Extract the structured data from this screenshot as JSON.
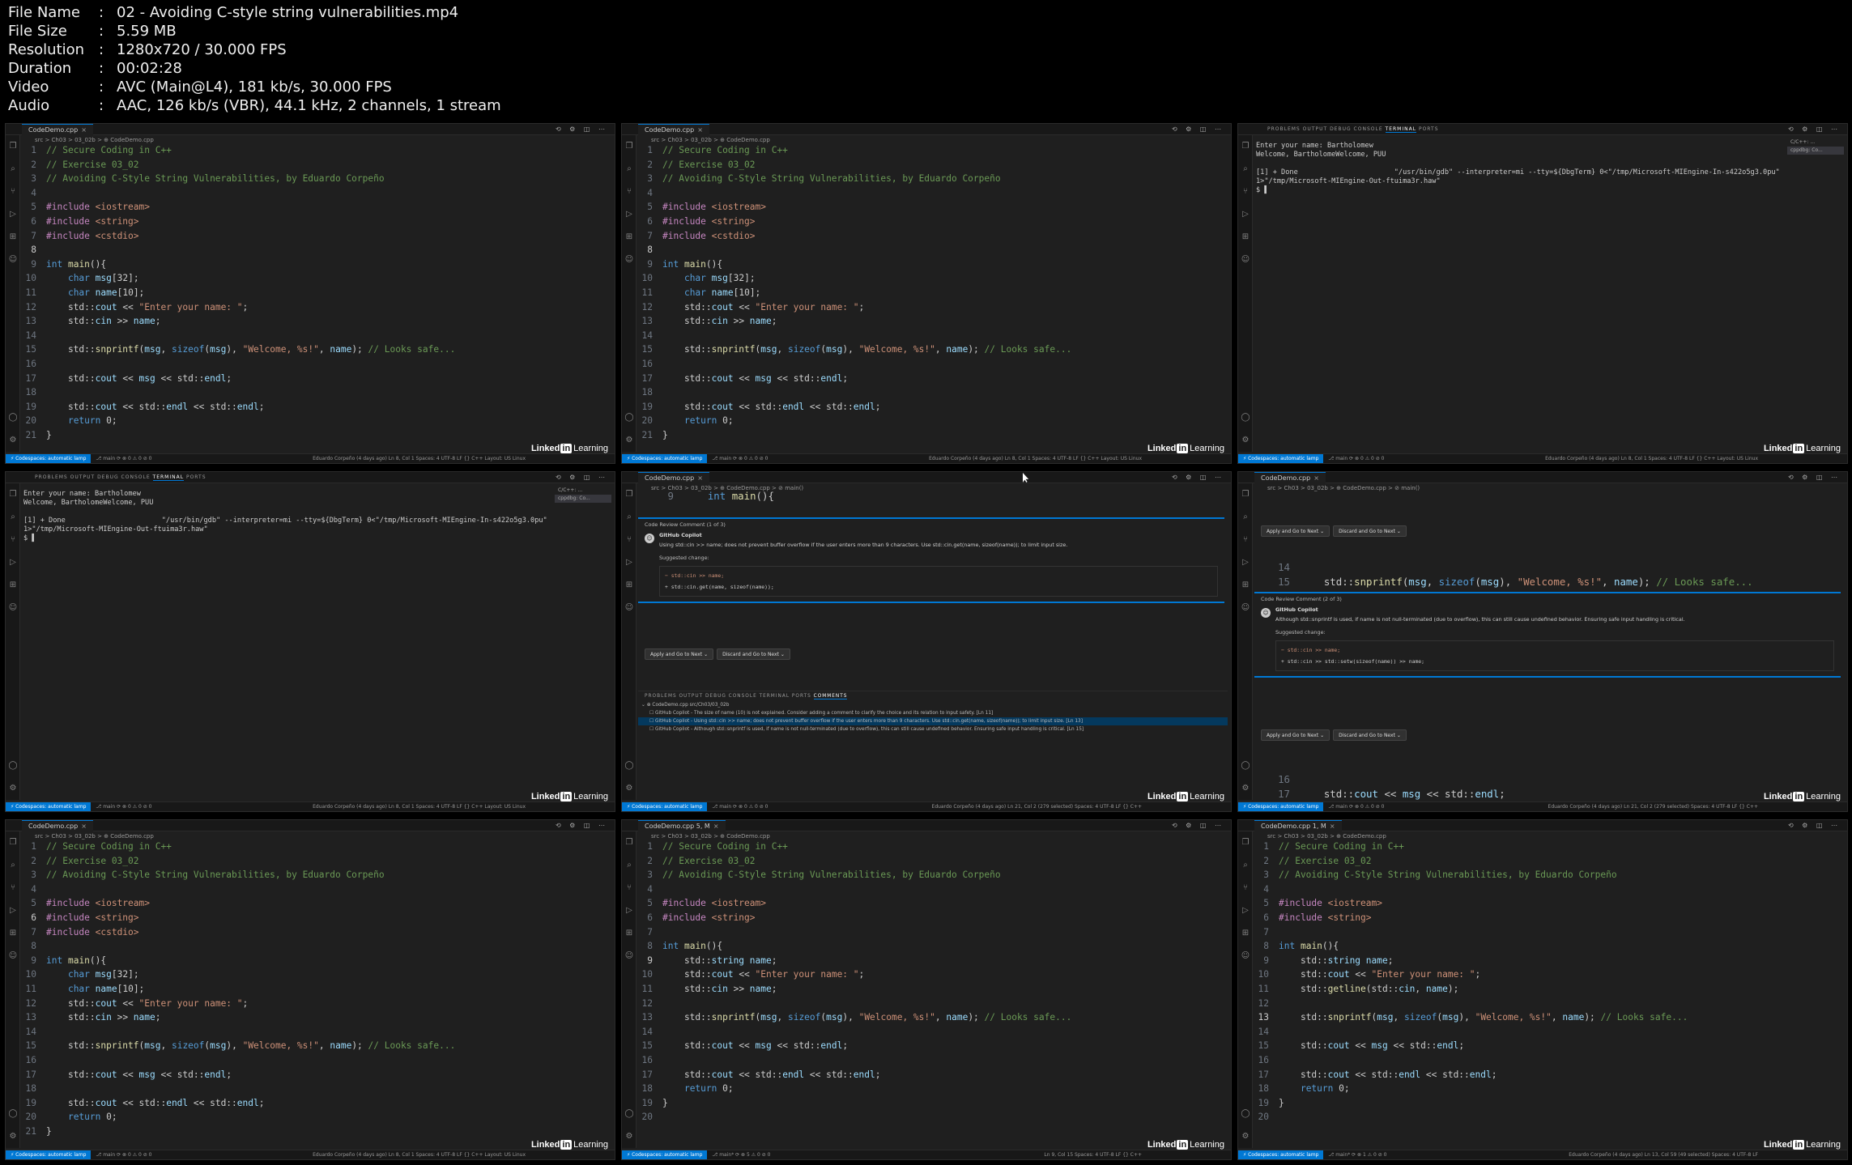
{
  "meta": [
    {
      "key": "File Name",
      "value": "02 - Avoiding C-style string vulnerabilities.mp4"
    },
    {
      "key": "File Size",
      "value": "5.59 MB"
    },
    {
      "key": "Resolution",
      "value": "1280x720 / 30.000 FPS"
    },
    {
      "key": "Duration",
      "value": "00:02:28"
    },
    {
      "key": "Video",
      "value": "AVC (Main@L4), 181 kb/s, 30.000 FPS"
    },
    {
      "key": "Audio",
      "value": "AAC, 126 kb/s (VBR), 44.1 kHz, 2 channels, 1 stream"
    }
  ],
  "editor": {
    "tab": "CodeDemo.cpp",
    "tab_modified": "CodeDemo.cpp 5, M",
    "tab_modified2": "CodeDemo.cpp 1, M",
    "breadcrumb": "src > Ch03 > 03_02b > ⊕ CodeDemo.cpp",
    "breadcrumb_main": "src > Ch03 > 03_02b > ⊕ CodeDemo.cpp > ⊘ main()",
    "actions": "⟲ ⚙ ◫ ⋯"
  },
  "status": {
    "remote": "⚡ Codespaces: automatic lamp",
    "branch": "⎇ main  ⟳  ⊗ 0 ⚠ 0  ⊘ 0",
    "branch_mod": "⎇ main*  ⟳  ⊗ 5 ⚠ 0  ⊘ 0",
    "branch_mod2": "⎇ main*  ⟳  ⊗ 1 ⚠ 0  ⊘ 0",
    "right": "Eduardo Corpeño (4 days ago)   Ln 8, Col 1   Spaces: 4   UTF-8   LF   {} C++   Layout: US   Linux",
    "right_sel": "Eduardo Corpeño (4 days ago)   Ln 21, Col 2 (279 selected)   Spaces: 4   UTF-8   LF   {} C++",
    "right_15": "Ln 9, Col 15   Spaces: 4   UTF-8   LF   {} C++",
    "right_13": "Eduardo Corpeño (4 days ago)   Ln 13, Col 59 (49 selected)   Spaces: 4   UTF-8   LF"
  },
  "linkedin": {
    "brand": "Linked",
    "box": "in",
    "learning": "Learning"
  },
  "code_original": [
    "// Secure Coding in C++",
    "// Exercise 03_02",
    "// Avoiding C-Style String Vulnerabilities, by Eduardo Corpeño",
    "",
    "#include <iostream>",
    "#include <string>",
    "#include <cstdio>",
    "",
    "int main(){",
    "    char msg[32];",
    "    char name[10];",
    "    std::cout << \"Enter your name: \";",
    "    std::cin >> name;",
    "",
    "    std::snprintf(msg, sizeof(msg), \"Welcome, %s!\", name); // Looks safe...",
    "",
    "    std::cout << msg << std::endl;",
    "",
    "    std::cout << std::endl << std::endl;",
    "    return 0;",
    "}"
  ],
  "code_edit": [
    "// Secure Coding in C++",
    "// Exercise 03_02",
    "// Avoiding C-Style String Vulnerabilities, by Eduardo Corpeño",
    "",
    "#include <iostream>",
    "#include <string>",
    "",
    "int main(){",
    "    std::string name;",
    "    std::cout << \"Enter your name: \";",
    "    std::cin >> name;",
    "",
    "    std::snprintf(msg, sizeof(msg), \"Welcome, %s!\", name); // Looks safe...",
    "",
    "    std::cout << msg << std::endl;",
    "",
    "    std::cout << std::endl << std::endl;",
    "    return 0;",
    "}",
    ""
  ],
  "code_final": [
    "// Secure Coding in C++",
    "// Exercise 03_02",
    "// Avoiding C-Style String Vulnerabilities, by Eduardo Corpeño",
    "",
    "#include <iostream>",
    "#include <string>",
    "",
    "int main(){",
    "    std::string name;",
    "    std::cout << \"Enter your name: \";",
    "    std::getline(std::cin, name);",
    "",
    "    std::snprintf(msg, sizeof(msg), \"Welcome, %s!\", name); // Looks safe...",
    "",
    "    std::cout << msg << std::endl;",
    "",
    "    std::cout << std::endl << std::endl;",
    "    return 0;",
    "}",
    ""
  ],
  "terminal": {
    "tabs": [
      "PROBLEMS",
      "OUTPUT",
      "DEBUG CONSOLE",
      "TERMINAL",
      "PORTS"
    ],
    "active_tab": "TERMINAL",
    "lines": [
      "Enter your name: Bartholomew",
      "Welcome, BartholomeWelcome, PUU",
      "",
      "[1] + Done                       \"/usr/bin/gdb\" --interpreter=mi --tty=${DbgTerm} 0<\"/tmp/Microsoft-MIEngine-In-s422o5g3.0pu\" 1>\"/tmp/Microsoft-MIEngine-Out-ftuima3r.haw\"",
      "$ ▌"
    ],
    "side": [
      "C/C++: ...",
      "cppdbg: Co..."
    ]
  },
  "review1": {
    "header": "Code Review Comment (1 of 3)",
    "author": "GitHub Copilot",
    "text": "Using std::cin >> name; does not prevent buffer overflow if the user enters more than 9 characters. Use std::cin.get(name, sizeof(name)); to limit input size.",
    "suggested": "Suggested change:",
    "del": "    std::cin >> name;",
    "add": "    std::cin.get(name, sizeof(name));",
    "apply": "Apply and Go to Next  ⌄",
    "discard": "Discard and Go to Next  ⌄"
  },
  "review2": {
    "header": "Code Review Comment (2 of 3)",
    "author": "GitHub Copilot",
    "text": "Although std::snprintf is used, if name is not null-terminated (due to overflow), this can still cause undefined behavior. Ensuring safe input handling is critical.",
    "suggested": "Suggested change:",
    "del": "    std::cin >> name;",
    "add": "    std::cin >> std::setw(sizeof(name)) >> name;"
  },
  "comments_panel": {
    "tabs": [
      "PROBLEMS",
      "OUTPUT",
      "DEBUG CONSOLE",
      "TERMINAL",
      "PORTS",
      "COMMENTS"
    ],
    "active_tab": "COMMENTS",
    "filter": "Filter (e.g. text, author)",
    "file": "⌄ ⊕ CodeDemo.cpp  src/Ch03/03_02b",
    "items": [
      "☐ GitHub Copilot - The size of name (10) is not explained. Consider adding a comment to clarify the choice and its relation to input safety. [Ln 11]",
      "☐ GitHub Copilot - Using std::cin >> name; does not prevent buffer overflow if the user enters more than 9 characters. Use std::cin.get(name, sizeof(name)); to limit input size. [Ln 13]",
      "☐ GitHub Copilot - Although std::snprintf is used, if name is not null-terminated (due to overflow), this can still cause undefined behavior. Ensuring safe input handling is critical. [Ln 15]"
    ]
  },
  "snippets": {
    "line9_num": "9",
    "line9": "int main(){",
    "line14_num": "14",
    "line15_num": "15",
    "line15": "std::snprintf(msg, sizeof(msg), \"Welcome, %s!\", name); // Looks safe...",
    "line16_num": "16",
    "line17_num": "17",
    "line17": "std::cout << msg << std::endl;"
  }
}
